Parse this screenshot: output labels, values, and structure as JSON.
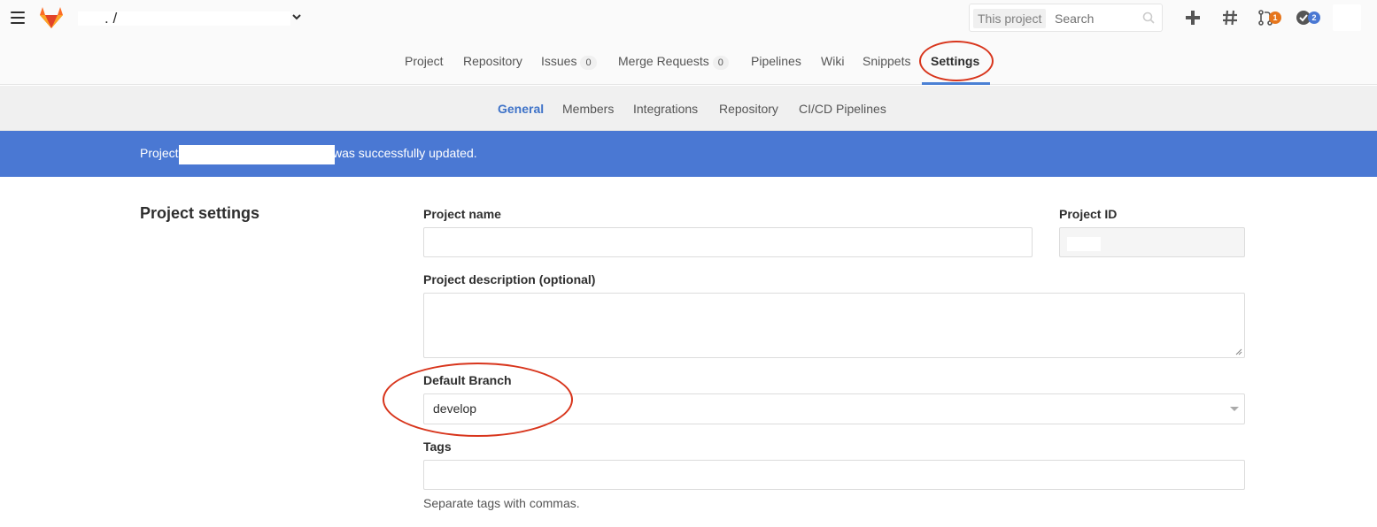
{
  "header": {
    "breadcrumb_separator": ". /",
    "search": {
      "scope": "This project",
      "placeholder": "Search"
    },
    "merge_requests_badge": "1",
    "todos_badge": "2",
    "colors": {
      "mr_badge": "#e6761d",
      "todo_badge": "#4a78d3",
      "accent": "#4a80d4"
    }
  },
  "project_nav": {
    "items": [
      {
        "label": "Project"
      },
      {
        "label": "Repository"
      },
      {
        "label": "Issues",
        "count": "0"
      },
      {
        "label": "Merge Requests",
        "count": "0"
      },
      {
        "label": "Pipelines"
      },
      {
        "label": "Wiki"
      },
      {
        "label": "Snippets"
      },
      {
        "label": "Settings",
        "active": true
      }
    ]
  },
  "sub_nav": {
    "items": [
      {
        "label": "General",
        "active": true
      },
      {
        "label": "Members"
      },
      {
        "label": "Integrations"
      },
      {
        "label": "Repository"
      },
      {
        "label": "CI/CD Pipelines"
      }
    ]
  },
  "flash": {
    "prefix": "Project",
    "suffix": "was successfully updated."
  },
  "settings": {
    "title": "Project settings",
    "project_name_label": "Project name",
    "project_id_label": "Project ID",
    "description_label": "Project description (optional)",
    "default_branch_label": "Default Branch",
    "default_branch_value": "develop",
    "tags_label": "Tags",
    "tags_help": "Separate tags with commas."
  }
}
